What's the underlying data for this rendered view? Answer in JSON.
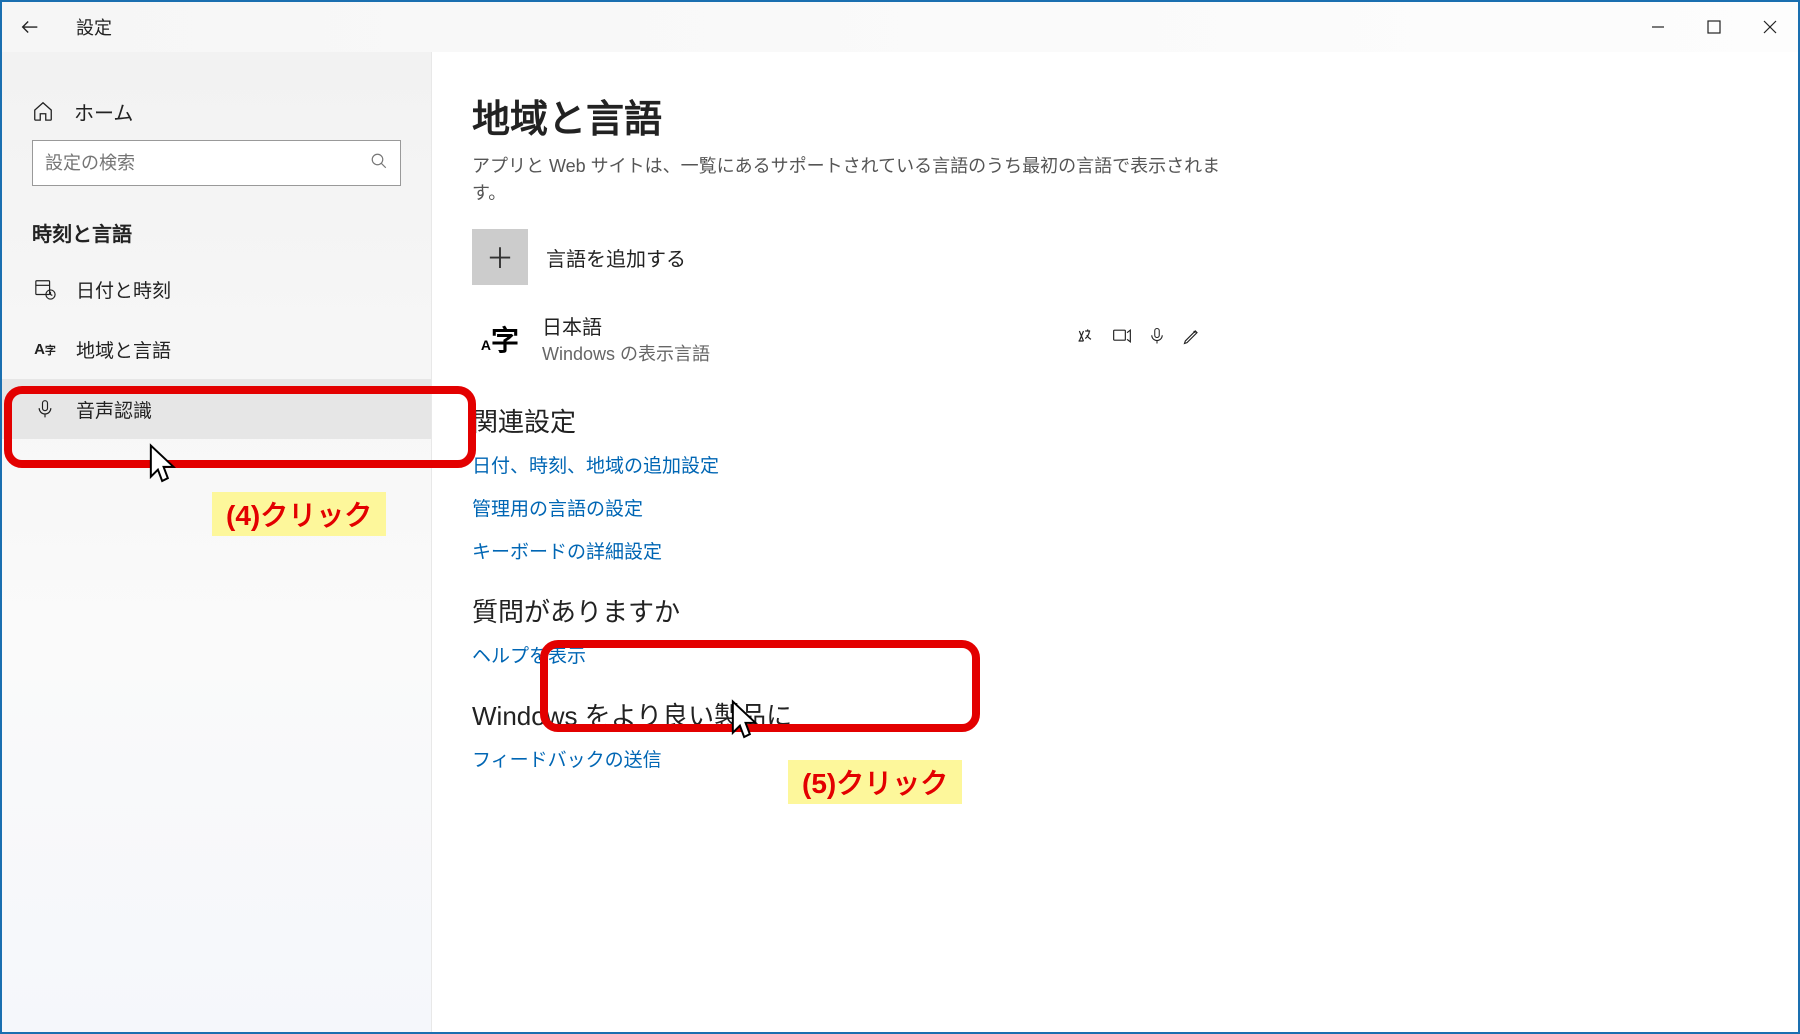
{
  "titlebar": {
    "title": "設定"
  },
  "sidebar": {
    "home_label": "ホーム",
    "search_placeholder": "設定の検索",
    "section_label": "時刻と言語",
    "items": [
      {
        "label": "日付と時刻"
      },
      {
        "label": "地域と言語"
      },
      {
        "label": "音声認識"
      }
    ]
  },
  "main": {
    "title": "地域と言語",
    "subtitle": "アプリと Web サイトは、一覧にあるサポートされている言語のうち最初の言語で表示されます。",
    "add_language_label": "言語を追加する",
    "language": {
      "name": "日本語",
      "sub": "Windows の表示言語"
    },
    "related_heading": "関連設定",
    "related_links": [
      "日付、時刻、地域の追加設定",
      "管理用の言語の設定",
      "キーボードの詳細設定"
    ],
    "questions_heading": "質問がありますか",
    "help_link": "ヘルプを表示",
    "improve_heading": "Windows をより良い製品に",
    "feedback_link": "フィードバックの送信"
  },
  "annotations": {
    "step4": "(4)クリック",
    "step5": "(5)クリック"
  }
}
